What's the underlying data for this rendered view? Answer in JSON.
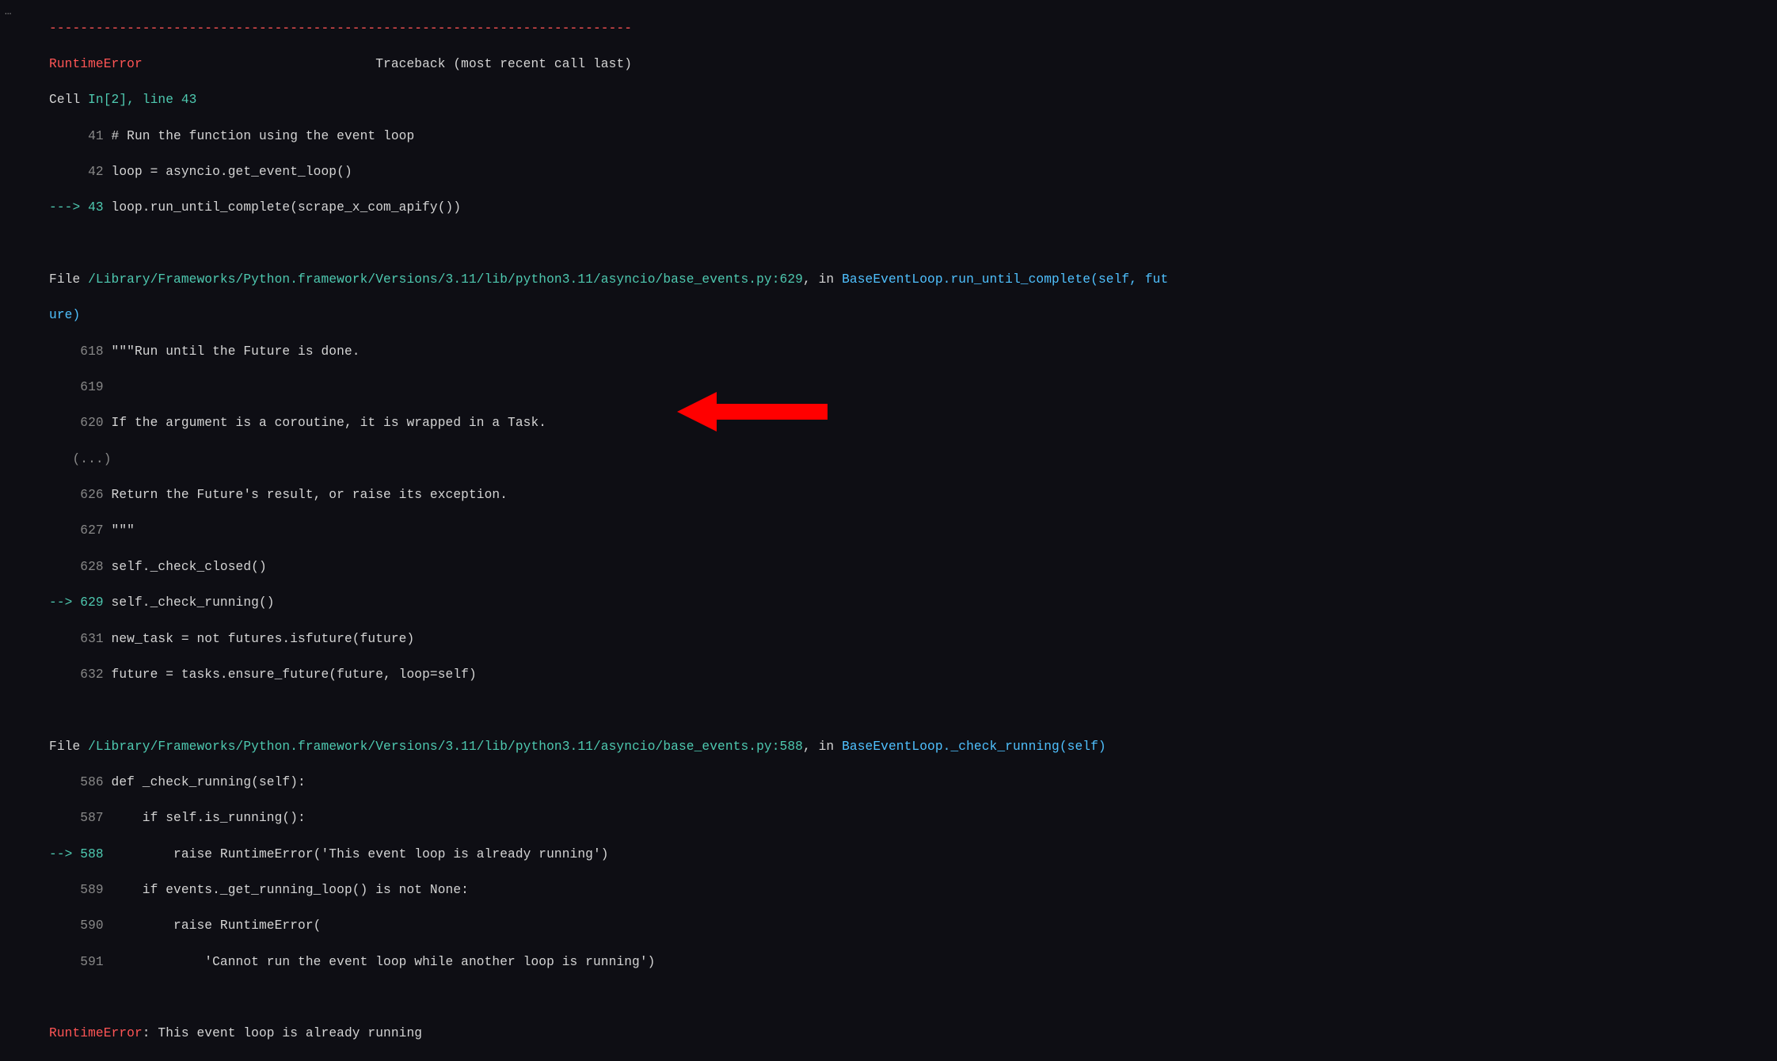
{
  "ellipsis": "…",
  "sep": "---------------------------------------------------------------------------",
  "error_name": "RuntimeError",
  "traceback_label": "                              Traceback (most recent call last)",
  "cell_prefix": "Cell ",
  "cell_in": "In[2], line 43",
  "lines_cell": {
    "l41_num": "     41 ",
    "l41": "# Run the function using the event loop",
    "l42_num": "     42 ",
    "l42": "loop = asyncio.get_event_loop()",
    "l43_arrow": "---> 43 ",
    "l43": "loop.run_until_complete(scrape_x_com_apify())"
  },
  "frame1": {
    "file_label": "File ",
    "path": "/Library/Frameworks/Python.framework/Versions/3.11/lib/python3.11/asyncio/base_events.py:629",
    "in_label": ", in ",
    "func": "BaseEventLoop.run_until_complete",
    "args1": "(self, fut",
    "args2": "ure)",
    "l618_num": "    618 ",
    "l618": "\"\"\"Run until the Future is done.",
    "l619_num": "    619 ",
    "l619": "",
    "l620_num": "    620 ",
    "l620": "If the argument is a coroutine, it is wrapped in a Task.",
    "ellipsis_line": "   (...)",
    "l626_num": "    626 ",
    "l626": "Return the Future's result, or raise its exception.",
    "l627_num": "    627 ",
    "l627": "\"\"\"",
    "l628_num": "    628 ",
    "l628": "self._check_closed()",
    "l629_arrow": "--> 629 ",
    "l629": "self._check_running()",
    "l631_num": "    631 ",
    "l631": "new_task = not futures.isfuture(future)",
    "l632_num": "    632 ",
    "l632": "future = tasks.ensure_future(future, loop=self)"
  },
  "frame2": {
    "file_label": "File ",
    "path": "/Library/Frameworks/Python.framework/Versions/3.11/lib/python3.11/asyncio/base_events.py:588",
    "in_label": ", in ",
    "func": "BaseEventLoop._check_running",
    "args": "(self)",
    "l586_num": "    586 ",
    "l586": "def _check_running(self):",
    "l587_num": "    587 ",
    "l587": "    if self.is_running():",
    "l588_arrow": "--> 588 ",
    "l588": "        raise RuntimeError('This event loop is already running')",
    "l589_num": "    589 ",
    "l589": "    if events._get_running_loop() is not None:",
    "l590_num": "    590 ",
    "l590": "        raise RuntimeError(",
    "l591_num": "    591 ",
    "l591": "            'Cannot run the event loop while another loop is running')"
  },
  "final_error_name": "RuntimeError",
  "final_error_msg": ": This event loop is already running",
  "colors": {
    "red": "#ff5555",
    "cyan": "#4ec9b0",
    "blue": "#4fc1ff",
    "grey": "#888888",
    "fg": "#d4d4d4",
    "bg": "#0e0e14",
    "arrow_red": "#ff0000"
  }
}
